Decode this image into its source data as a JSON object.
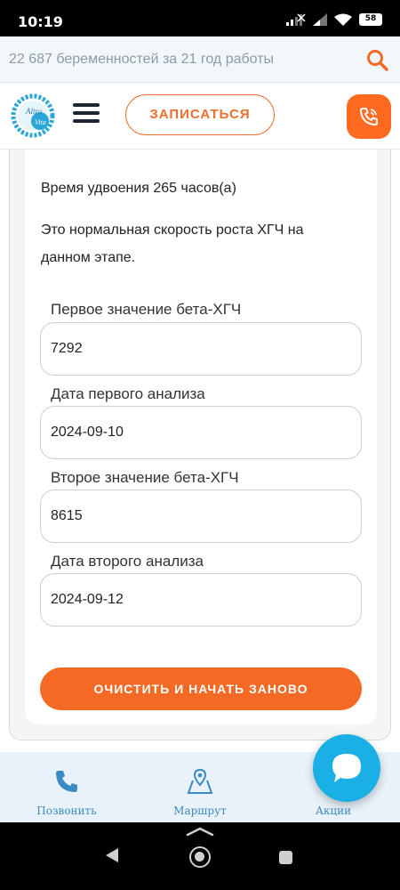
{
  "status_bar": {
    "time": "10:19",
    "battery": "58"
  },
  "search": {
    "text": "22 687 беременностей за 21 год работы"
  },
  "header": {
    "logo_text_top": "Altra",
    "logo_text_bottom": "Vita",
    "signup_label": "ЗАПИСАТЬСЯ"
  },
  "result": {
    "doubling_time": "Время удвоения 265 часов(а)",
    "message_line1": "Это нормальная скорость роста ХГЧ на",
    "message_line2": "данном этапе."
  },
  "form": {
    "fields": [
      {
        "label": "Первое значение бета-ХГЧ",
        "value": "7292"
      },
      {
        "label": "Дата первого анализа",
        "value": "2024-09-10"
      },
      {
        "label": "Второе значение бета-ХГЧ",
        "value": "8615"
      },
      {
        "label": "Дата второго анализа",
        "value": "2024-09-12"
      }
    ],
    "reset_label": "ОЧИСТИТЬ И НАЧАТЬ ЗАНОВО"
  },
  "bottom_nav": {
    "items": [
      {
        "label": "Позвонить",
        "icon": "phone-icon"
      },
      {
        "label": "Маршрут",
        "icon": "map-pin-icon"
      },
      {
        "label": "Акции",
        "icon": "tag-icon"
      }
    ]
  },
  "colors": {
    "accent": "#f46a25",
    "link": "#3a8bc4",
    "fab": "#1ab0e6"
  }
}
